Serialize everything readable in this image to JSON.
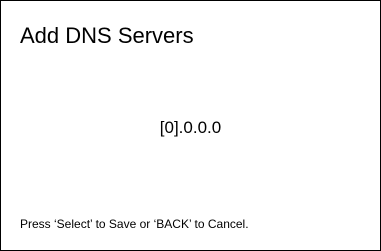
{
  "screen": {
    "title": "Add DNS Servers",
    "ip_value": "[0].0.0.0",
    "hint": "Press ‘Select’ to Save or ‘BACK’ to Cancel."
  }
}
